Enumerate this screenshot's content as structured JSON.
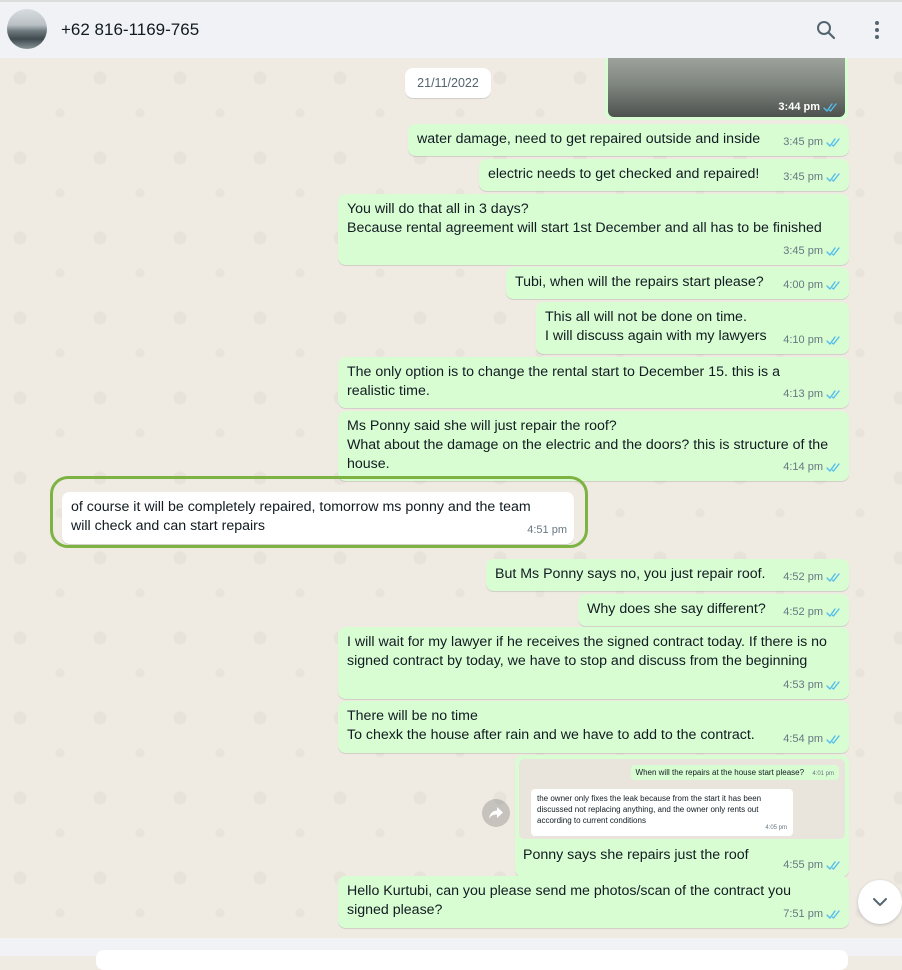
{
  "header": {
    "contact_name": "+62 816-1169-765",
    "icons": [
      "search-icon",
      "menu-icon"
    ]
  },
  "chat": {
    "date_divider": "21/11/2022",
    "image_message": {
      "time": "3:44 pm"
    },
    "messages": [
      {
        "direction": "out",
        "text": "water damage, need to get repaired outside and inside",
        "time": "3:45 pm"
      },
      {
        "direction": "out",
        "text": "electric needs to get checked and repaired!",
        "time": "3:45 pm"
      },
      {
        "direction": "out",
        "text": "You will do that all in 3 days?\nBecause rental agreement will start 1st December and all has to be finished",
        "time": "3:45 pm"
      },
      {
        "direction": "out",
        "text": "Tubi, when will the repairs start please?",
        "time": "4:00 pm"
      },
      {
        "direction": "out",
        "text": "This all will not be done on time.\nI will discuss again with my lawyers",
        "time": "4:10 pm"
      },
      {
        "direction": "out",
        "text": "The only option is to change the rental start to December 15. this is a realistic time.",
        "time": "4:13 pm"
      },
      {
        "direction": "out",
        "text": "Ms Ponny said she will just repair the roof?\nWhat about the damage on the electric and the doors? this is structure of the house.",
        "time": "4:14 pm"
      },
      {
        "direction": "in",
        "text": "of course it will be completely repaired, tomorrow ms ponny and the team will check and can start repairs",
        "time": "4:51 pm"
      },
      {
        "direction": "out",
        "text": "But Ms Ponny says no, you just repair roof.",
        "time": "4:52 pm"
      },
      {
        "direction": "out",
        "text": "Why does she say different?",
        "time": "4:52 pm"
      },
      {
        "direction": "out",
        "text": "I will wait for my lawyer if he receives the signed contract today. If there is no signed contract by today, we have to stop and discuss from the beginning",
        "time": "4:53 pm"
      },
      {
        "direction": "out",
        "text": "There will be no time\nTo chexk the house after rain and we have to add to the contract.",
        "time": "4:54 pm"
      },
      {
        "direction": "out",
        "caption": "Ponny says she repairs just the roof",
        "time": "4:55 pm",
        "screenshot": {
          "out_text": "When will the repairs at the house start please?",
          "out_time": "4:01 pm",
          "in_text": "the owner only fixes the leak because from the start it has been discussed not replacing anything, and the owner only rents out according to current conditions",
          "in_time": "4:05 pm"
        }
      },
      {
        "direction": "out",
        "text": "Hello Kurtubi, can you please send me photos/scan of the contract you signed please?",
        "time": "7:51 pm"
      }
    ]
  },
  "colors": {
    "outgoing_bubble": "#d9fdd3",
    "incoming_bubble": "#ffffff",
    "highlight_border": "#7cb342",
    "read_ticks": "#53bdeb"
  }
}
